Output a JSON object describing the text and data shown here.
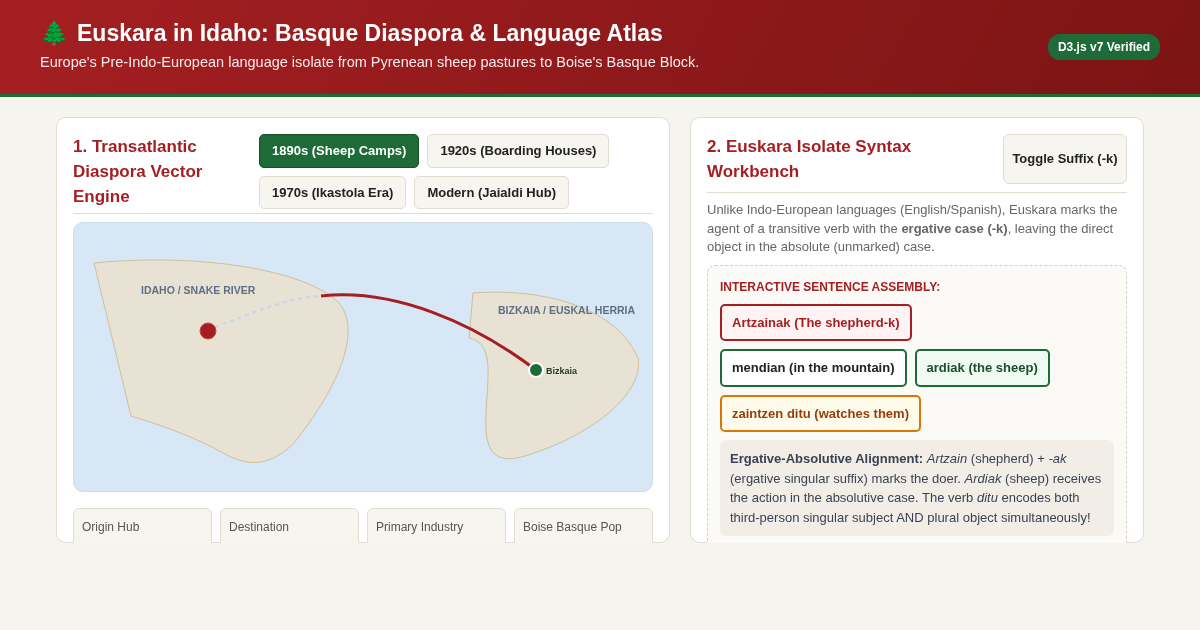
{
  "header": {
    "icon": "🌲",
    "title": "Euskara in Idaho: Basque Diaspora & Language Atlas",
    "subtitle": "Europe's Pre-Indo-European language isolate from Pyrenean sheep pastures to Boise's Basque Block.",
    "badge": "D3.js v7 Verified"
  },
  "diaspora": {
    "title": "1. Transatlantic Diaspora Vector Engine",
    "eras": [
      {
        "label": "1890s (Sheep Camps)",
        "selected": true
      },
      {
        "label": "1920s (Boarding Houses)",
        "selected": false
      },
      {
        "label": "1970s (Ikastola Era)",
        "selected": false
      },
      {
        "label": "Modern (Jaialdi Hub)",
        "selected": false
      }
    ],
    "map": {
      "left_region": "IDAHO / SNAKE RIVER",
      "right_region": "BIZKAIA / EUSKAL HERRIA",
      "origin_label": "Bizkaia"
    },
    "stats": [
      {
        "label": "Origin Hub"
      },
      {
        "label": "Destination"
      },
      {
        "label": "Primary Industry"
      },
      {
        "label": "Boise Basque Pop"
      }
    ]
  },
  "syntax": {
    "title": "2. Euskara Isolate Syntax Workbench",
    "toggle": "Toggle Suffix (-k)",
    "intro": "Unlike Indo-European languages (English/Spanish), Euskara marks the agent of a transitive verb with the **ergative case (-k)**, leaving the direct object in the absolute (unmarked) case.",
    "assembly_title": "INTERACTIVE SENTENCE ASSEMBLY:",
    "tokens": [
      {
        "text": "Artzainak (The shepherd-k)",
        "kind": "agent"
      },
      {
        "text": "mendian (in the mountain)",
        "kind": "location"
      },
      {
        "text": "ardiak (the sheep)",
        "kind": "object"
      },
      {
        "text": "zaintzen ditu (watches them)",
        "kind": "verb"
      }
    ],
    "note": "**Ergative-Absolutive Alignment:** *Artzain* (shepherd) + *-ak* (ergative singular suffix) marks the doer. *Ardiak* (sheep) receives the action in the absolutive case. The verb *ditu* encodes both third-person singular subject AND plural object simultaneously!"
  }
}
